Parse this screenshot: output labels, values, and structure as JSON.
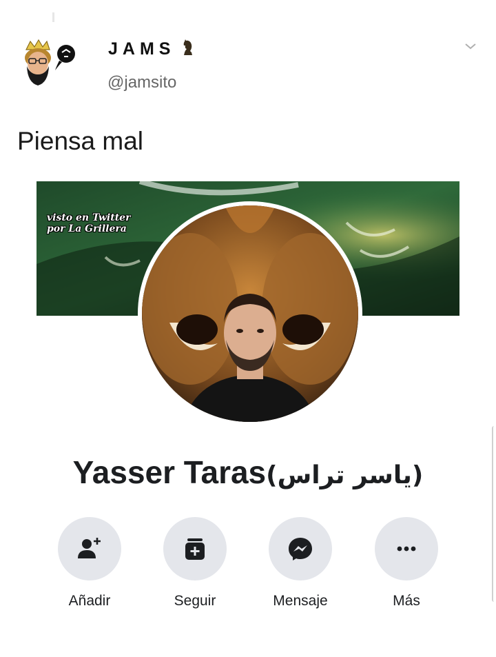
{
  "tweet": {
    "display_name": "JAMS",
    "handle": "@jamsito",
    "text": "Piensa mal"
  },
  "cover": {
    "watermark_line1": "visto en Twitter",
    "watermark_line2": "por La Grillera"
  },
  "profile": {
    "name_latin": "Yasser Taras",
    "name_arabic": "(ياسر تراس)"
  },
  "actions": [
    {
      "label": "Añadir",
      "icon": "add-friend-icon"
    },
    {
      "label": "Seguir",
      "icon": "follow-icon"
    },
    {
      "label": "Mensaje",
      "icon": "messenger-icon"
    },
    {
      "label": "Más",
      "icon": "more-icon"
    }
  ],
  "colors": {
    "button_bg": "#e4e6eb",
    "icon_color": "#1c1e21",
    "handle_color": "#666666"
  }
}
